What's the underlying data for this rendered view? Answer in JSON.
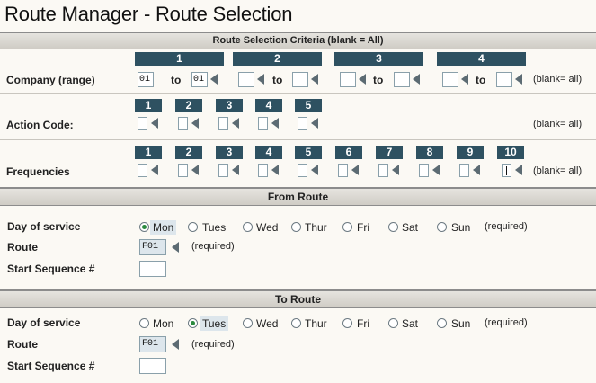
{
  "window": {
    "title": "Route Manager - Route Selection"
  },
  "criteria": {
    "heading": "Route Selection Criteria (blank = All)",
    "company": {
      "label": "Company (range)",
      "to_label": "to",
      "hint": "(blank= all)",
      "columns": [
        {
          "number": "1",
          "from": "01",
          "to": "01"
        },
        {
          "number": "2",
          "from": "",
          "to": ""
        },
        {
          "number": "3",
          "from": "",
          "to": ""
        },
        {
          "number": "4",
          "from": "",
          "to": ""
        }
      ]
    },
    "action_code": {
      "label": "Action Code:",
      "hint": "(blank= all)",
      "columns": [
        "1",
        "2",
        "3",
        "4",
        "5"
      ]
    },
    "frequencies": {
      "label": "Frequencies",
      "hint": "(blank= all)",
      "columns": [
        "1",
        "2",
        "3",
        "4",
        "5",
        "6",
        "7",
        "8",
        "9",
        "10"
      ]
    }
  },
  "from_route": {
    "heading": "From Route",
    "day_label": "Day of service",
    "days": [
      "Mon",
      "Tues",
      "Wed",
      "Thur",
      "Fri",
      "Sat",
      "Sun"
    ],
    "selected_day": "Mon",
    "required": "(required)",
    "route_label": "Route",
    "route_value": "F01",
    "route_required": "(required)",
    "start_seq_label": "Start Sequence #",
    "start_seq_value": ""
  },
  "to_route": {
    "heading": "To Route",
    "day_label": "Day of service",
    "days": [
      "Mon",
      "Tues",
      "Wed",
      "Thur",
      "Fri",
      "Sat",
      "Sun"
    ],
    "selected_day": "Tues",
    "required": "(required)",
    "route_label": "Route",
    "route_value": "F01",
    "route_required": "(required)",
    "start_seq_label": "Start Sequence #",
    "start_seq_value": ""
  },
  "colors": {
    "header_bg": "#2e5161",
    "selected_radio": "#2b8a3e",
    "band_bg": "#d9d6cf"
  }
}
